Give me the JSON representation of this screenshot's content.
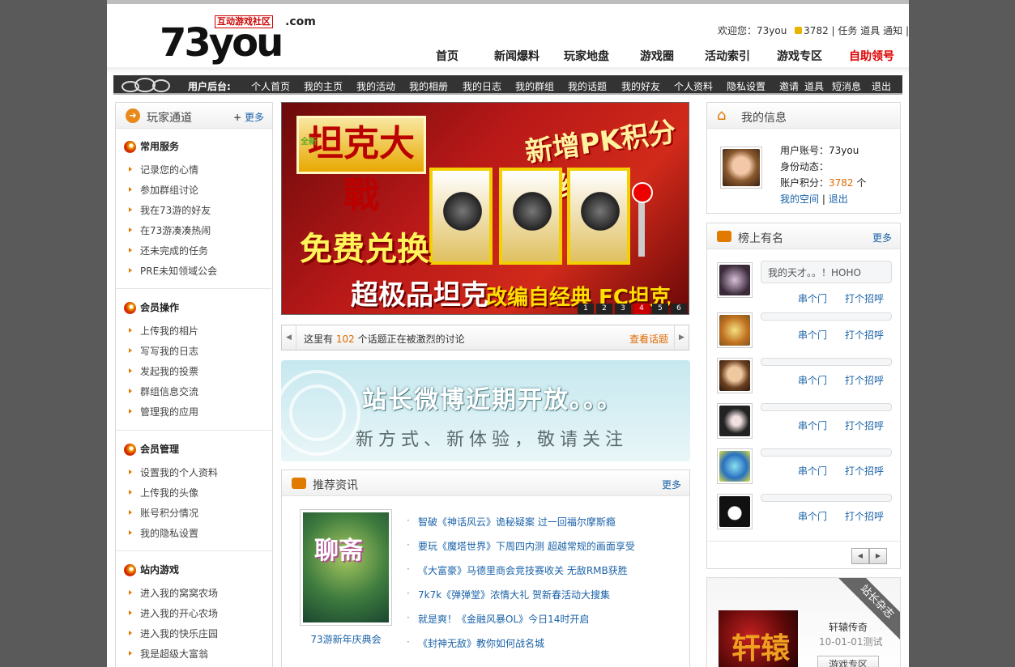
{
  "logo": {
    "sub": "互动游戏社区",
    "domain": ".com",
    "main": "73you"
  },
  "topbar": {
    "welcome": "欢迎您：73you",
    "points": "3782",
    "sep1": "|",
    "task": "任务",
    "props": "道具",
    "notice": "通知",
    "sep2": "|"
  },
  "main_nav": [
    "首页",
    "新闻爆料",
    "玩家地盘",
    "游戏圈",
    "活动索引",
    "游戏专区",
    "自助领号"
  ],
  "user_bar": {
    "label": "用户后台:",
    "items": [
      "个人首页",
      "我的主页",
      "我的活动",
      "我的相册",
      "我的日志",
      "我的群组",
      "我的话题",
      "我的好友",
      "个人资料",
      "隐私设置",
      "邀请",
      "道具",
      "短消息",
      "退出"
    ]
  },
  "left": {
    "title": "玩家通道",
    "more": "更多",
    "groups": [
      {
        "title": "常用服务",
        "items": [
          "记录您的心情",
          "参加群组讨论",
          "我在73游的好友",
          "在73游凑凑热闹",
          "还未完成的任务",
          "PRE未知领域公会"
        ]
      },
      {
        "title": "会员操作",
        "items": [
          "上传我的相片",
          "写写我的日志",
          "发起我的投票",
          "群组信息交流",
          "管理我的应用"
        ]
      },
      {
        "title": "会员管理",
        "items": [
          "设置我的个人资料",
          "上传我的头像",
          "账号积分情况",
          "我的隐私设置"
        ]
      },
      {
        "title": "站内游戏",
        "items": [
          "进入我的窝窝农场",
          "进入我的开心农场",
          "进入我的快乐庄园",
          "我是超级大富翁"
        ]
      }
    ]
  },
  "banner": {
    "badge": "全新",
    "title": "坦克大戰",
    "headline": "新增PK积分系统",
    "free": "免费兑换",
    "super": "超极品坦克",
    "fc": "改编自经典 FC坦克大战",
    "pages": [
      "1",
      "2",
      "3",
      "4",
      "5",
      "6"
    ],
    "active_page": 4
  },
  "topic_bar": {
    "prefix": "这里有",
    "count": "102",
    "suffix": "个话题正在被激烈的讨论",
    "link": "查看话题"
  },
  "weibo": {
    "headline": "站长微博近期开放。。。",
    "sub": "新方式、新体验，敬请关注"
  },
  "news": {
    "title": "推荐资讯",
    "more": "更多",
    "pic_text": "聊斋",
    "caption": "73游新年庆典会",
    "items": [
      "智破《神话风云》诡秘疑案 过一回福尔摩斯瘾",
      "要玩《魔塔世界》下周四内测 超越常规的画面享受",
      "《大富豪》马德里商会竞技赛收关 无敌RMB获胜",
      "7k7k《弹弹堂》浓情大礼 贺新春活动大搜集",
      "就是爽！《金融风暴OL》今日14时开启",
      "《封神无敌》教你如何战名城"
    ]
  },
  "myinfo": {
    "title": "我的信息",
    "account_label": "用户账号：",
    "account": "73you",
    "status_label": "身份动态：",
    "points_label": "账户积分：",
    "points": "3782",
    "points_unit": "个",
    "space": "我的空间",
    "sep": "|",
    "logout": "退出"
  },
  "rank": {
    "title": "榜上有名",
    "more": "更多",
    "first_msg": "我的天才。。！HOHO",
    "action1": "串个门",
    "action2": "打个招呼",
    "count": 6
  },
  "magazine": {
    "ribbon": "站长杂志",
    "img_text": "轩辕",
    "name": "轩辕传奇",
    "date": "10-01-01测试",
    "button": "游戏专区"
  },
  "colors": {
    "accent": "#e06a00",
    "link": "#1a62a8",
    "bar": "#333333",
    "banner": "#b81818"
  }
}
